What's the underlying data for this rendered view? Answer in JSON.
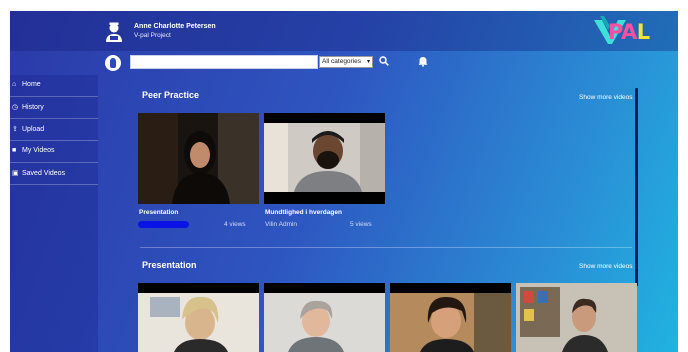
{
  "user": {
    "name": "Anne Charlotte Petersen",
    "project": "V-pal Project"
  },
  "brand": {
    "logo_text_left": "V",
    "logo_text_pa": "PA",
    "logo_text_right": "L"
  },
  "search": {
    "placeholder": "",
    "category_selected": "All categories"
  },
  "sidebar": {
    "items": [
      {
        "label": "Home",
        "icon": "home-icon"
      },
      {
        "label": "History",
        "icon": "clock-icon"
      },
      {
        "label": "Upload",
        "icon": "upload-icon"
      },
      {
        "label": "My Videos",
        "icon": "video-camera-icon"
      },
      {
        "label": "Saved Videos",
        "icon": "save-icon"
      }
    ]
  },
  "sections": [
    {
      "title": "Peer Practice",
      "show_more": "Show more videos",
      "videos": [
        {
          "title": "Presentation",
          "author": "",
          "views": "4 views"
        },
        {
          "title": "Mundtlighed i hverdagen",
          "author": "Vilin Admin",
          "views": "5 views"
        }
      ]
    },
    {
      "title": "Presentation",
      "show_more": "Show more videos",
      "videos": [
        {
          "title": ""
        },
        {
          "title": ""
        },
        {
          "title": ""
        },
        {
          "title": ""
        }
      ]
    }
  ],
  "colors": {
    "accent_gradient_start": "#2b3aa8",
    "accent_gradient_end": "#20b3e0",
    "redaction": "#0a12e6"
  }
}
